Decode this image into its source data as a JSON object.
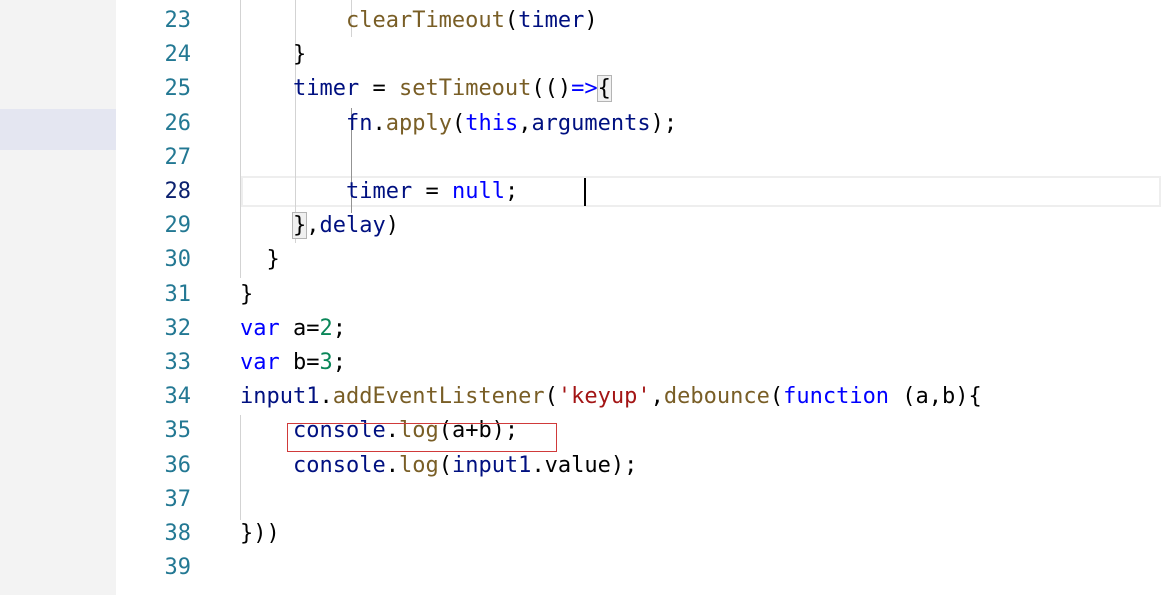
{
  "editor": {
    "active_line": 28,
    "annotated_line": 35,
    "lines": [
      {
        "num": "23",
        "indent": "        ",
        "tokens": [
          {
            "t": "clearTimeout",
            "c": "fn"
          },
          {
            "t": "(",
            "c": ""
          },
          {
            "t": "timer",
            "c": "var"
          },
          {
            "t": ")",
            "c": ""
          }
        ]
      },
      {
        "num": "24",
        "indent": "    ",
        "tokens": [
          {
            "t": "}",
            "c": ""
          }
        ]
      },
      {
        "num": "25",
        "indent": "    ",
        "tokens": [
          {
            "t": "timer",
            "c": "var"
          },
          {
            "t": " = ",
            "c": ""
          },
          {
            "t": "setTimeout",
            "c": "fn"
          },
          {
            "t": "(()",
            "c": ""
          },
          {
            "t": "=>",
            "c": "kw"
          },
          {
            "t": "{",
            "c": "brace-match"
          }
        ]
      },
      {
        "num": "26",
        "indent": "        ",
        "tokens": [
          {
            "t": "fn",
            "c": "var"
          },
          {
            "t": ".",
            "c": ""
          },
          {
            "t": "apply",
            "c": "fn"
          },
          {
            "t": "(",
            "c": ""
          },
          {
            "t": "this",
            "c": "kw"
          },
          {
            "t": ",",
            "c": ""
          },
          {
            "t": "arguments",
            "c": "var"
          },
          {
            "t": ");",
            "c": ""
          }
        ]
      },
      {
        "num": "27",
        "indent": "",
        "tokens": []
      },
      {
        "num": "28",
        "indent": "        ",
        "tokens": [
          {
            "t": "timer",
            "c": "var"
          },
          {
            "t": " = ",
            "c": ""
          },
          {
            "t": "null",
            "c": "kw"
          },
          {
            "t": ";",
            "c": ""
          }
        ]
      },
      {
        "num": "29",
        "indent": "    ",
        "tokens": [
          {
            "t": "}",
            "c": "brace-match"
          },
          {
            "t": ",",
            "c": ""
          },
          {
            "t": "delay",
            "c": "var"
          },
          {
            "t": ")",
            "c": ""
          }
        ]
      },
      {
        "num": "30",
        "indent": "  ",
        "tokens": [
          {
            "t": "}",
            "c": ""
          }
        ]
      },
      {
        "num": "31",
        "indent": "",
        "tokens": [
          {
            "t": "}",
            "c": ""
          }
        ]
      },
      {
        "num": "32",
        "indent": "",
        "tokens": [
          {
            "t": "var",
            "c": "kw"
          },
          {
            "t": " a=",
            "c": ""
          },
          {
            "t": "2",
            "c": "num"
          },
          {
            "t": ";",
            "c": ""
          }
        ]
      },
      {
        "num": "33",
        "indent": "",
        "tokens": [
          {
            "t": "var",
            "c": "kw"
          },
          {
            "t": " b=",
            "c": ""
          },
          {
            "t": "3",
            "c": "num"
          },
          {
            "t": ";",
            "c": ""
          }
        ]
      },
      {
        "num": "34",
        "indent": "",
        "tokens": [
          {
            "t": "input1",
            "c": "var"
          },
          {
            "t": ".",
            "c": ""
          },
          {
            "t": "addEventListener",
            "c": "fn"
          },
          {
            "t": "(",
            "c": ""
          },
          {
            "t": "'keyup'",
            "c": "str"
          },
          {
            "t": ",",
            "c": ""
          },
          {
            "t": "debounce",
            "c": "fn"
          },
          {
            "t": "(",
            "c": ""
          },
          {
            "t": "function",
            "c": "kw"
          },
          {
            "t": " (a,b){",
            "c": ""
          }
        ]
      },
      {
        "num": "35",
        "indent": "    ",
        "tokens": [
          {
            "t": "console",
            "c": "var"
          },
          {
            "t": ".",
            "c": ""
          },
          {
            "t": "log",
            "c": "fn"
          },
          {
            "t": "(a+b);",
            "c": ""
          }
        ]
      },
      {
        "num": "36",
        "indent": "    ",
        "tokens": [
          {
            "t": "console",
            "c": "var"
          },
          {
            "t": ".",
            "c": ""
          },
          {
            "t": "log",
            "c": "fn"
          },
          {
            "t": "(",
            "c": ""
          },
          {
            "t": "input1",
            "c": "var"
          },
          {
            "t": ".value);",
            "c": ""
          }
        ]
      },
      {
        "num": "37",
        "indent": "",
        "tokens": []
      },
      {
        "num": "38",
        "indent": "",
        "tokens": [
          {
            "t": "}))",
            "c": ""
          }
        ]
      },
      {
        "num": "39",
        "indent": "",
        "tokens": []
      }
    ]
  },
  "colors": {
    "keyword": "#0000ff",
    "function": "#795e26",
    "variable": "#001080",
    "string": "#a31515",
    "number": "#098658",
    "line_number": "#237893",
    "annotation_box": "#d03a3a"
  }
}
